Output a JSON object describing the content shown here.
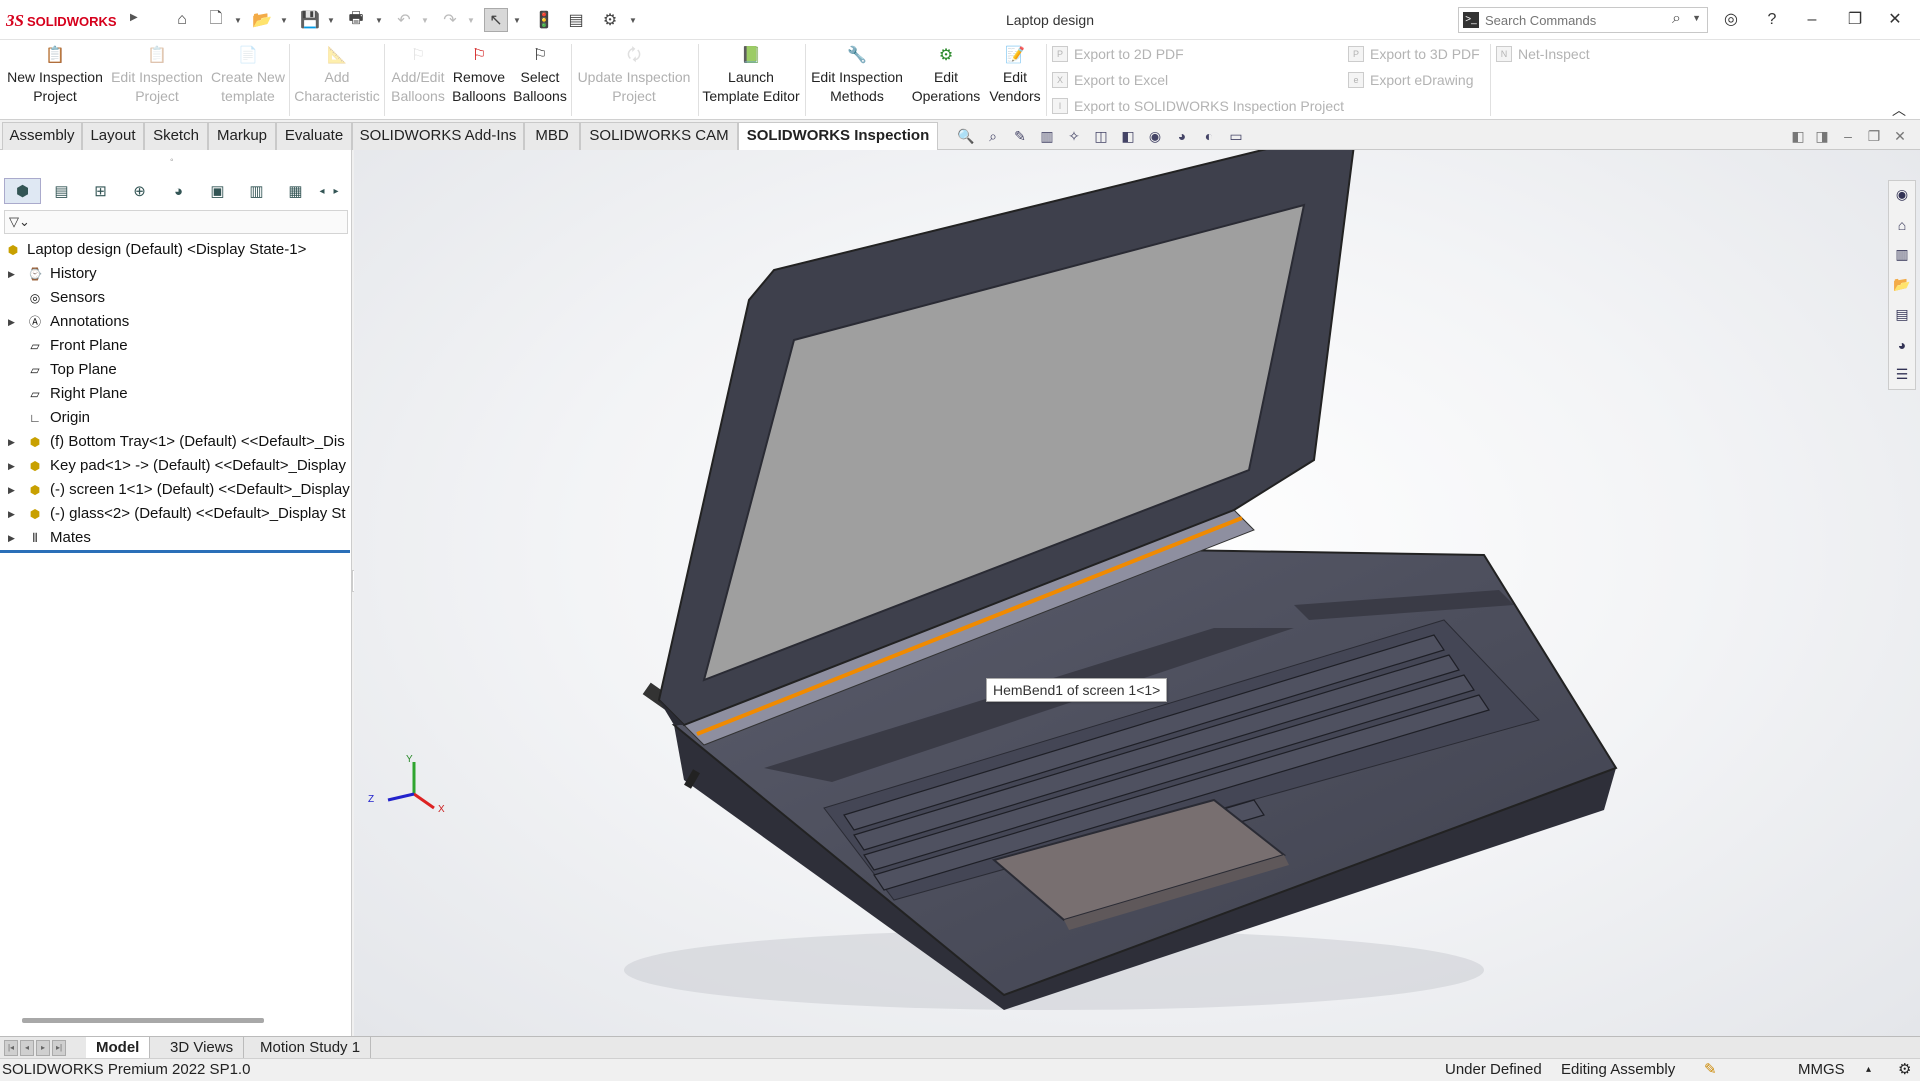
{
  "app": {
    "brand": "SOLIDWORKS",
    "window_title": "Laptop design"
  },
  "search": {
    "placeholder": "Search Commands"
  },
  "ribbon": {
    "buttons": [
      {
        "label1": "New Inspection",
        "label2": "Project",
        "enabled": true
      },
      {
        "label1": "Edit Inspection",
        "label2": "Project",
        "enabled": false
      },
      {
        "label1": "Create New",
        "label2": "template",
        "enabled": false
      },
      {
        "label1": "Add",
        "label2": "Characteristic",
        "enabled": false
      },
      {
        "label1": "Add/Edit",
        "label2": "Balloons",
        "enabled": false
      },
      {
        "label1": "Remove",
        "label2": "Balloons",
        "enabled": true
      },
      {
        "label1": "Select",
        "label2": "Balloons",
        "enabled": true
      },
      {
        "label1": "Update Inspection",
        "label2": "Project",
        "enabled": false
      },
      {
        "label1": "Launch",
        "label2": "Template Editor",
        "enabled": true
      },
      {
        "label1": "Edit Inspection",
        "label2": "Methods",
        "enabled": true
      },
      {
        "label1": "Edit",
        "label2": "Operations",
        "enabled": true
      },
      {
        "label1": "Edit",
        "label2": "Vendors",
        "enabled": true
      }
    ],
    "export": [
      "Export to 2D PDF",
      "Export to Excel",
      "Export to SOLIDWORKS Inspection Project",
      "Export to 3D PDF",
      "Export eDrawing",
      "Net-Inspect"
    ]
  },
  "tabs": [
    "Assembly",
    "Layout",
    "Sketch",
    "Markup",
    "Evaluate",
    "SOLIDWORKS Add-Ins",
    "MBD",
    "SOLIDWORKS CAM",
    "SOLIDWORKS Inspection"
  ],
  "active_tab": "SOLIDWORKS Inspection",
  "tree": {
    "root": "Laptop design (Default) <Display State-1>",
    "items": [
      "History",
      "Sensors",
      "Annotations",
      "Front Plane",
      "Top Plane",
      "Right Plane",
      "Origin",
      "(f) Bottom Tray<1> (Default) <<Default>_Dis",
      "Key pad<1> -> (Default) <<Default>_Display",
      "(-) screen 1<1> (Default) <<Default>_Display",
      "(-) glass<2> (Default) <<Default>_Display St",
      "Mates"
    ]
  },
  "viewport": {
    "tooltip": "HemBend1 of screen 1<1>",
    "triad": {
      "x": "X",
      "y": "Y",
      "z": "Z"
    }
  },
  "bottom_tabs": [
    "Model",
    "3D Views",
    "Motion Study 1"
  ],
  "status": {
    "product": "SOLIDWORKS Premium 2022 SP1.0",
    "state": "Under Defined",
    "mode": "Editing Assembly",
    "units": "MMGS"
  },
  "colors": {
    "accent": "#2a6fb8",
    "brand": "#d6001c",
    "highlight_edge": "#f08a00",
    "laptop_body": "#4d4f5e",
    "screen": "#9f9f9f",
    "touchpad": "#786f70"
  }
}
